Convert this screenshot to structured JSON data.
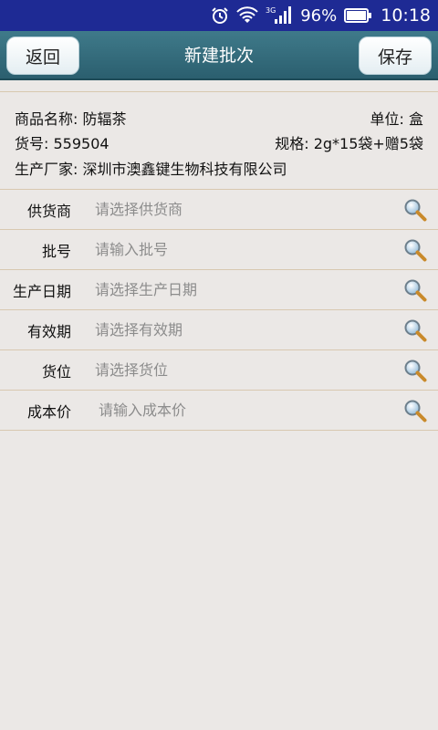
{
  "status_bar": {
    "network": "3G",
    "battery": "96%",
    "time": "10:18",
    "icons": [
      "alarm-icon",
      "wifi-icon",
      "signal-icon",
      "battery-icon"
    ]
  },
  "header": {
    "back_label": "返回",
    "title": "新建批次",
    "save_label": "保存"
  },
  "product": {
    "name_label": "商品名称:",
    "name_value": "防辐茶",
    "unit_label": "单位:",
    "unit_value": "盒",
    "code_label": "货号:",
    "code_value": "559504",
    "spec_label": "规格:",
    "spec_value": "2g*15袋+赠5袋",
    "maker_label": "生产厂家:",
    "maker_value": "深圳市澳鑫键生物科技有限公司"
  },
  "form": {
    "supplier": {
      "label": "供货商",
      "placeholder": "请选择供货商",
      "value": ""
    },
    "batch_no": {
      "label": "批号",
      "placeholder": "请输入批号",
      "value": ""
    },
    "prod_date": {
      "label": "生产日期",
      "placeholder": "请选择生产日期",
      "value": ""
    },
    "expiry": {
      "label": "有效期",
      "placeholder": "请选择有效期",
      "value": ""
    },
    "location": {
      "label": "货位",
      "placeholder": "请选择货位",
      "value": ""
    },
    "cost": {
      "label": "成本价",
      "placeholder": "请输入成本价",
      "value": ""
    }
  },
  "colors": {
    "status_bar": "#1e2a94",
    "header": "#2f6878",
    "background": "#ebe8e6",
    "divider": "#d8c8b0"
  }
}
